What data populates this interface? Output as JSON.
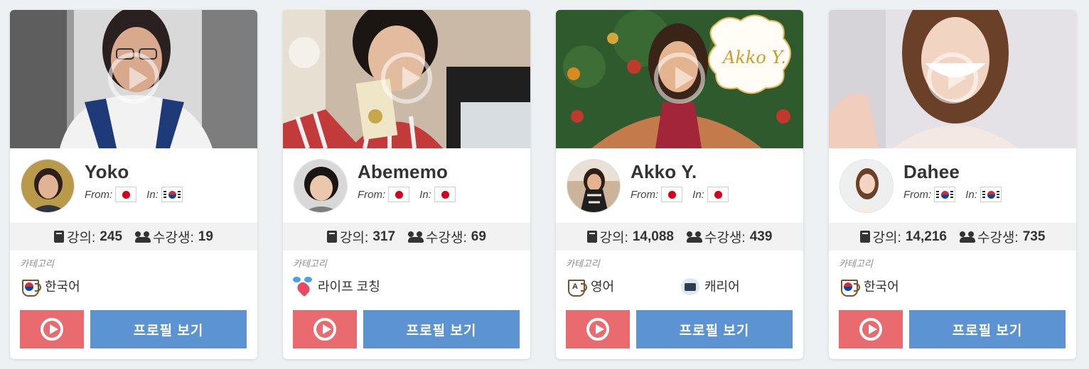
{
  "common": {
    "from_label": "From:",
    "in_label": "In:",
    "lessons_label": "강의:",
    "students_label": "수강생:",
    "category_heading": "카테고리",
    "profile_button_label": "프로필 보기"
  },
  "teachers": [
    {
      "name": "Yoko",
      "from_flag": "japan-flag",
      "in_flag": "korea-flag",
      "lessons": "245",
      "students": "19",
      "categories": [
        {
          "label": "한국어",
          "icon": "korean-cup-icon"
        }
      ]
    },
    {
      "name": "Abememo",
      "from_flag": "japan-flag",
      "in_flag": "japan-flag",
      "lessons": "317",
      "students": "69",
      "categories": [
        {
          "label": "라이프 코칭",
          "icon": "heart-chat-icon"
        }
      ]
    },
    {
      "name": "Akko Y.",
      "from_flag": "japan-flag",
      "in_flag": "japan-flag",
      "lessons": "14,088",
      "students": "439",
      "categories": [
        {
          "label": "영어",
          "icon": "english-cup-icon"
        },
        {
          "label": "캐리어",
          "icon": "briefcase-icon"
        }
      ]
    },
    {
      "name": "Dahee",
      "from_flag": "korea-flag",
      "in_flag": "korea-flag",
      "lessons": "14,216",
      "students": "735",
      "categories": [
        {
          "label": "한국어",
          "icon": "korean-cup-icon"
        }
      ]
    }
  ],
  "colors": {
    "video_button": "#ea6b6f",
    "profile_button": "#5b93d3",
    "stats_bar": "#f2f2f2",
    "page_background": "#eef1f3"
  }
}
